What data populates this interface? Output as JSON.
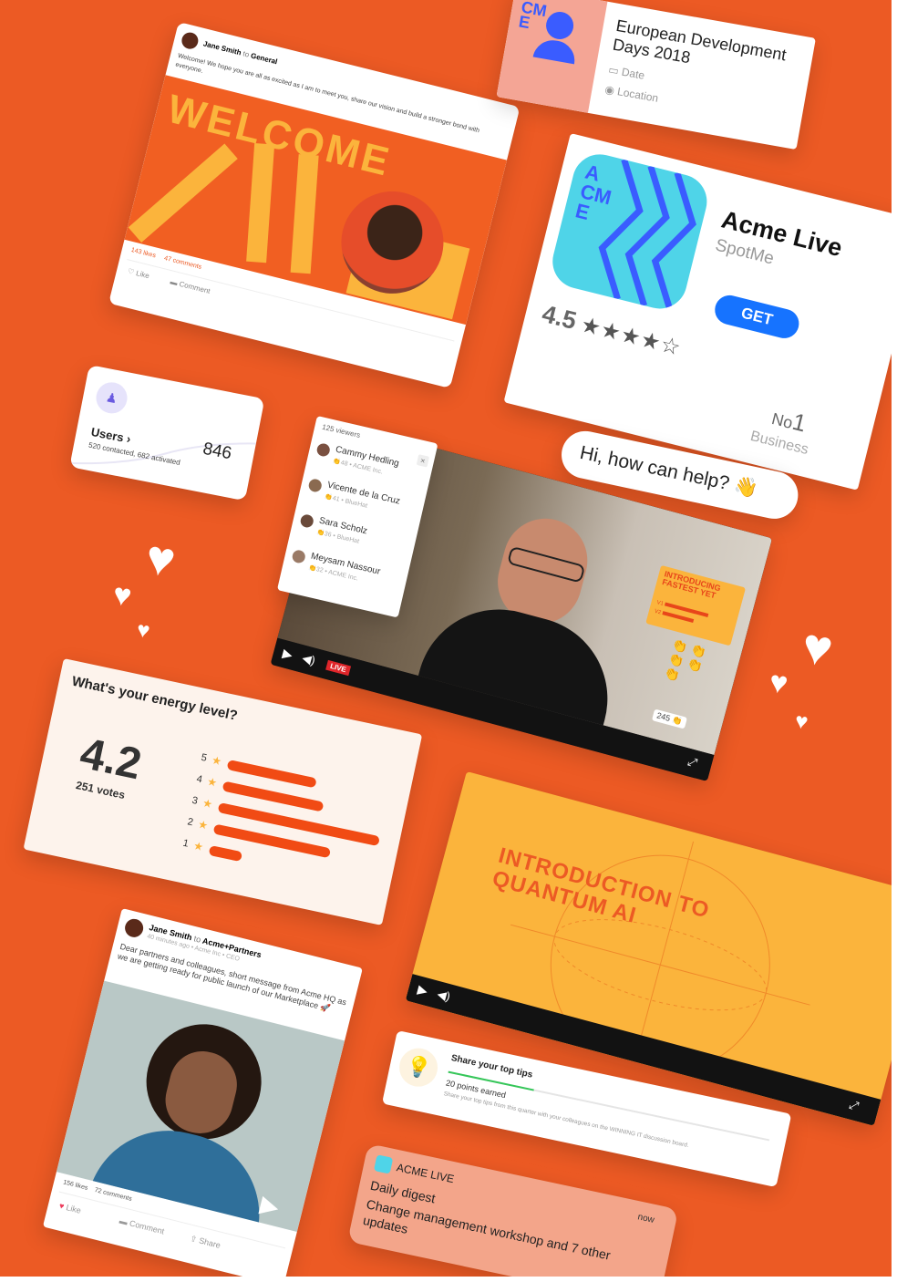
{
  "colors": {
    "background": "#ec5a24",
    "card": "#ffffff",
    "yellow": "#fbb43c",
    "orange_bar": "#f14b14",
    "teal": "#4fd4e8",
    "blue_accent": "#1673ff",
    "live_red": "#e0262b"
  },
  "welcome_post": {
    "author": "Jane Smith",
    "connector": "to",
    "channel": "General",
    "message": "Welcome! We hope you are all as excited as I am to meet you, share our vision and build a stronger bond with everyone.",
    "banner_text": "WELCOME",
    "likes": "143 likes",
    "comments": "47 comments",
    "like_label": "Like",
    "comment_label": "Comment"
  },
  "event_card": {
    "logo_text": "CM E",
    "title": "European Development Days 2018",
    "date_label": "Date",
    "location_label": "Location",
    "date_icon": "calendar-icon",
    "location_icon": "location-pin-icon"
  },
  "app_store": {
    "logo_text": "A CM E",
    "app_name": "Acme Live",
    "developer": "SpotMe",
    "get_label": "GET",
    "rating": "4.5",
    "rating_value": 4.5,
    "rank_prefix": "No",
    "rank_number": "1",
    "category": "Business"
  },
  "users_widget": {
    "label": "Users",
    "count": "846",
    "detail": "520 contacted, 682 activated",
    "icon": "users-icon"
  },
  "chat_bubble": {
    "text": "Hi, how can help? 👋"
  },
  "viewers_panel": {
    "title": "125 viewers",
    "viewers": [
      {
        "name": "Cammy Hedling",
        "meta": "👏48 • ACME Inc."
      },
      {
        "name": "Vicente de la Cruz",
        "meta": "👏41 • BlueHat"
      },
      {
        "name": "Sara Scholz",
        "meta": "👏36 • BlueHat"
      },
      {
        "name": "Meysam Nassour",
        "meta": "👏32 • ACME Inc."
      }
    ]
  },
  "live_video": {
    "live_label": "LIVE",
    "poll_title": "INTRODUCING FASTEST YET",
    "poll_options": [
      {
        "label": "V1",
        "fraction": 0.7
      },
      {
        "label": "V2",
        "fraction": 0.5
      }
    ],
    "clap_count": "245"
  },
  "energy_poll": {
    "question": "What's your energy level?",
    "average": "4.2",
    "votes": "251 votes",
    "rows": [
      {
        "star": "5",
        "fraction": 0.55
      },
      {
        "star": "4",
        "fraction": 0.62
      },
      {
        "star": "3",
        "fraction": 1.0
      },
      {
        "star": "2",
        "fraction": 0.72
      },
      {
        "star": "1",
        "fraction": 0.2
      }
    ]
  },
  "quantum_video": {
    "title_line1": "INTRODUCTION TO",
    "title_line2": "QUANTUM AI"
  },
  "partner_post": {
    "author": "Jane Smith",
    "connector": "to",
    "channel": "Acme+Partners",
    "meta": "40 minutes ago • Acme Inc • CEO",
    "message": "Dear partners and colleagues, short message from Acme HQ as we are getting ready for public launch of our Marketplace 🚀",
    "likes": "156 likes",
    "comments": "72 comments",
    "like_label": "Like",
    "comment_label": "Comment",
    "share_label": "Share"
  },
  "tips_card": {
    "title": "Share your top tips",
    "points": "20 points earned",
    "description": "Share your top tips from this quarter with your colleagues on the WINNING IT discussion board.",
    "icon": "lightbulb-icon"
  },
  "notification": {
    "app": "ACME LIVE",
    "time": "now",
    "title": "Daily digest",
    "body": "Change management workshop and 7 other updates"
  }
}
